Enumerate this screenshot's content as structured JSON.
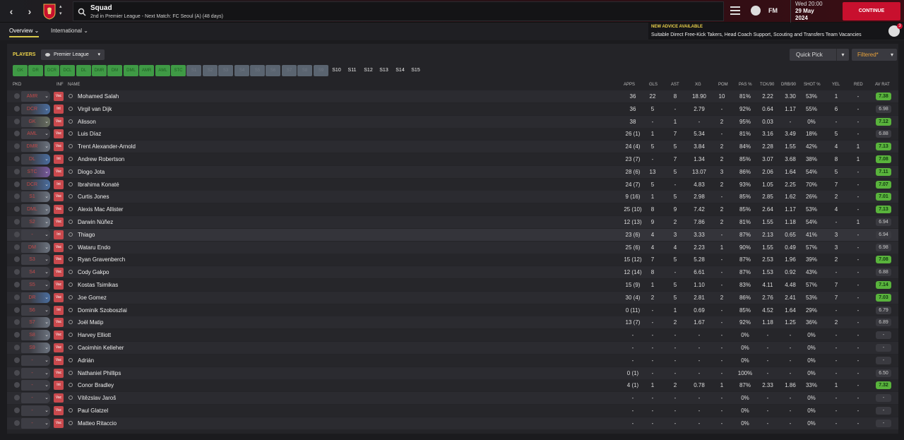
{
  "topbar": {
    "title": "Squad",
    "subtitle": "2nd in Premier League - Next Match: FC Seoul (A) (48 days)",
    "date_line1": "Wed 20:00",
    "date_line2": "29 May",
    "date_line3": "2024",
    "fm_label": "FM",
    "continue_label": "CONTINUE"
  },
  "tabs": [
    {
      "label": "Overview ⌄"
    },
    {
      "label": "International ⌄"
    }
  ],
  "advice": {
    "heading": "NEW ADVICE AVAILABLE",
    "body": "Suitable Direct Free-Kick Takers, Head Coach Support, Scouting and Transfers Team Vacancies",
    "badge": "3"
  },
  "panel": {
    "players_label": "PLAYERS",
    "league": "Premier League",
    "quick_pick": "Quick Pick",
    "filtered": "Filtered*"
  },
  "position_chips": [
    "GK",
    "DR",
    "DCR",
    "DCL",
    "DL",
    "DMR",
    "DM",
    "DML",
    "AMR",
    "AML",
    "STC",
    "S1",
    "S2",
    "S3",
    "S4",
    "S5",
    "S6",
    "S7",
    "S8",
    "S9",
    "S10",
    "S11",
    "S12",
    "S13",
    "S14",
    "S15"
  ],
  "columns": {
    "pkd": "PKD",
    "inf": "INF",
    "name": "NAME",
    "apps": "APPS",
    "gls": "GLS",
    "ast": "AST",
    "xg": "XG",
    "pom": "POM",
    "pas": "PAS %",
    "tck": "TCK/90",
    "drb": "DRB/90",
    "shot": "SHOT %",
    "yel": "YEL",
    "red": "RED",
    "avrat": "AV RAT"
  },
  "players": [
    {
      "pos": "AMR",
      "inf": "Vac",
      "name": "Mohamed Salah",
      "apps": "36",
      "gls": "22",
      "ast": "8",
      "xg": "18.90",
      "pom": "10",
      "pas": "81%",
      "tck": "2.22",
      "drb": "3.30",
      "shot": "53%",
      "yel": "1",
      "red": "-",
      "rat": "7.38",
      "good": true,
      "hue": "none"
    },
    {
      "pos": "DCR",
      "inf": "Int",
      "name": "Virgil van Dijk",
      "apps": "36",
      "gls": "5",
      "ast": "-",
      "xg": "2.79",
      "pom": "-",
      "pas": "92%",
      "tck": "0.64",
      "drb": "1.17",
      "shot": "55%",
      "yel": "6",
      "red": "-",
      "rat": "6.98",
      "good": false,
      "hue": "blu"
    },
    {
      "pos": "GK",
      "inf": "Vac",
      "name": "Alisson",
      "apps": "38",
      "gls": "-",
      "ast": "1",
      "xg": "-",
      "pom": "2",
      "pas": "95%",
      "tck": "0.03",
      "drb": "-",
      "shot": "0%",
      "yel": "-",
      "red": "-",
      "rat": "7.12",
      "good": true,
      "hue": "grn"
    },
    {
      "pos": "AML",
      "inf": "Vac",
      "name": "Luis Díaz",
      "apps": "26 (1)",
      "gls": "1",
      "ast": "7",
      "xg": "5.34",
      "pom": "-",
      "pas": "81%",
      "tck": "3.16",
      "drb": "3.49",
      "shot": "18%",
      "yel": "5",
      "red": "-",
      "rat": "6.88",
      "good": false,
      "hue": "none"
    },
    {
      "pos": "DMR",
      "inf": "Vac",
      "name": "Trent Alexander-Arnold",
      "apps": "24 (4)",
      "gls": "5",
      "ast": "5",
      "xg": "3.84",
      "pom": "2",
      "pas": "84%",
      "tck": "2.28",
      "drb": "1.55",
      "shot": "42%",
      "yel": "4",
      "red": "1",
      "rat": "7.13",
      "good": true,
      "hue": "gry"
    },
    {
      "pos": "DL",
      "inf": "Int",
      "name": "Andrew Robertson",
      "apps": "23 (7)",
      "gls": "-",
      "ast": "7",
      "xg": "1.34",
      "pom": "2",
      "pas": "85%",
      "tck": "3.07",
      "drb": "3.68",
      "shot": "38%",
      "yel": "8",
      "red": "1",
      "rat": "7.08",
      "good": true,
      "hue": "blu"
    },
    {
      "pos": "STC",
      "inf": "Vac",
      "name": "Diogo Jota",
      "apps": "28 (6)",
      "gls": "13",
      "ast": "5",
      "xg": "13.07",
      "pom": "3",
      "pas": "86%",
      "tck": "2.06",
      "drb": "1.64",
      "shot": "54%",
      "yel": "5",
      "red": "-",
      "rat": "7.11",
      "good": true,
      "hue": "pur"
    },
    {
      "pos": "DCR",
      "inf": "Int",
      "name": "Ibrahima Konaté",
      "apps": "24 (7)",
      "gls": "5",
      "ast": "-",
      "xg": "4.83",
      "pom": "2",
      "pas": "93%",
      "tck": "1.05",
      "drb": "2.25",
      "shot": "70%",
      "yel": "7",
      "red": "-",
      "rat": "7.07",
      "good": true,
      "hue": "blu"
    },
    {
      "pos": "S1",
      "inf": "Vac",
      "name": "Curtis Jones",
      "apps": "9 (16)",
      "gls": "1",
      "ast": "5",
      "xg": "2.98",
      "pom": "-",
      "pas": "85%",
      "tck": "2.85",
      "drb": "1.62",
      "shot": "26%",
      "yel": "2",
      "red": "-",
      "rat": "7.01",
      "good": true,
      "hue": "gry"
    },
    {
      "pos": "DML",
      "inf": "Vac",
      "name": "Alexis Mac Allister",
      "apps": "25 (10)",
      "gls": "8",
      "ast": "9",
      "xg": "7.42",
      "pom": "2",
      "pas": "85%",
      "tck": "2.64",
      "drb": "1.17",
      "shot": "53%",
      "yel": "4",
      "red": "-",
      "rat": "7.13",
      "good": true,
      "hue": "gry"
    },
    {
      "pos": "S2",
      "inf": "Vac",
      "name": "Darwin Núñez",
      "apps": "12 (13)",
      "gls": "9",
      "ast": "2",
      "xg": "7.86",
      "pom": "2",
      "pas": "81%",
      "tck": "1.55",
      "drb": "1.18",
      "shot": "54%",
      "yel": "-",
      "red": "1",
      "rat": "6.94",
      "good": false,
      "hue": "gry"
    },
    {
      "pos": "-",
      "inf": "Int",
      "name": "Thiago",
      "apps": "23 (6)",
      "gls": "4",
      "ast": "3",
      "xg": "3.33",
      "pom": "-",
      "pas": "87%",
      "tck": "2.13",
      "drb": "0.65",
      "shot": "41%",
      "yel": "3",
      "red": "-",
      "rat": "6.94",
      "good": false,
      "hue": "none"
    },
    {
      "pos": "DM",
      "inf": "Vac",
      "name": "Wataru Endo",
      "apps": "25 (6)",
      "gls": "4",
      "ast": "4",
      "xg": "2.23",
      "pom": "1",
      "pas": "90%",
      "tck": "1.55",
      "drb": "0.49",
      "shot": "57%",
      "yel": "3",
      "red": "-",
      "rat": "6.98",
      "good": false,
      "hue": "gry"
    },
    {
      "pos": "S3",
      "inf": "Vac",
      "name": "Ryan Gravenberch",
      "apps": "15 (12)",
      "gls": "7",
      "ast": "5",
      "xg": "5.28",
      "pom": "-",
      "pas": "87%",
      "tck": "2.53",
      "drb": "1.96",
      "shot": "39%",
      "yel": "2",
      "red": "-",
      "rat": "7.08",
      "good": true,
      "hue": "none"
    },
    {
      "pos": "S4",
      "inf": "Vac",
      "name": "Cody Gakpo",
      "apps": "12 (14)",
      "gls": "8",
      "ast": "-",
      "xg": "6.61",
      "pom": "-",
      "pas": "87%",
      "tck": "1.53",
      "drb": "0.92",
      "shot": "43%",
      "yel": "-",
      "red": "-",
      "rat": "6.88",
      "good": false,
      "hue": "none"
    },
    {
      "pos": "S5",
      "inf": "Vac",
      "name": "Kostas Tsimikas",
      "apps": "15 (9)",
      "gls": "1",
      "ast": "5",
      "xg": "1.10",
      "pom": "-",
      "pas": "83%",
      "tck": "4.11",
      "drb": "4.48",
      "shot": "57%",
      "yel": "7",
      "red": "-",
      "rat": "7.14",
      "good": true,
      "hue": "none"
    },
    {
      "pos": "DR",
      "inf": "Vac",
      "name": "Joe Gomez",
      "apps": "30 (4)",
      "gls": "2",
      "ast": "5",
      "xg": "2.81",
      "pom": "2",
      "pas": "86%",
      "tck": "2.76",
      "drb": "2.41",
      "shot": "53%",
      "yel": "7",
      "red": "-",
      "rat": "7.03",
      "good": true,
      "hue": "blu"
    },
    {
      "pos": "S6",
      "inf": "Int",
      "name": "Dominik Szoboszlai",
      "apps": "0 (11)",
      "gls": "-",
      "ast": "1",
      "xg": "0.69",
      "pom": "-",
      "pas": "85%",
      "tck": "4.52",
      "drb": "1.64",
      "shot": "29%",
      "yel": "-",
      "red": "-",
      "rat": "6.79",
      "good": false,
      "hue": "none"
    },
    {
      "pos": "S7",
      "inf": "Vac",
      "name": "Joël Matip",
      "apps": "13 (7)",
      "gls": "-",
      "ast": "2",
      "xg": "1.67",
      "pom": "-",
      "pas": "92%",
      "tck": "1.18",
      "drb": "1.25",
      "shot": "36%",
      "yel": "2",
      "red": "-",
      "rat": "6.89",
      "good": false,
      "hue": "gry"
    },
    {
      "pos": "S8",
      "inf": "Vac",
      "name": "Harvey Elliott",
      "apps": "-",
      "gls": "-",
      "ast": "-",
      "xg": "-",
      "pom": "-",
      "pas": "0%",
      "tck": "-",
      "drb": "-",
      "shot": "0%",
      "yel": "-",
      "red": "-",
      "rat": "-",
      "good": false,
      "hue": "gry"
    },
    {
      "pos": "S9",
      "inf": "Vac",
      "name": "Caoimhin Kelleher",
      "apps": "-",
      "gls": "-",
      "ast": "-",
      "xg": "-",
      "pom": "-",
      "pas": "0%",
      "tck": "-",
      "drb": "-",
      "shot": "0%",
      "yel": "-",
      "red": "-",
      "rat": "-",
      "good": false,
      "hue": "gry"
    },
    {
      "pos": "-",
      "inf": "Vac",
      "name": "Adrián",
      "apps": "-",
      "gls": "-",
      "ast": "-",
      "xg": "-",
      "pom": "-",
      "pas": "0%",
      "tck": "-",
      "drb": "-",
      "shot": "0%",
      "yel": "-",
      "red": "-",
      "rat": "-",
      "good": false,
      "hue": "none"
    },
    {
      "pos": "-",
      "inf": "Vac",
      "name": "Nathaniel Phillips",
      "apps": "0 (1)",
      "gls": "-",
      "ast": "-",
      "xg": "-",
      "pom": "-",
      "pas": "100%",
      "tck": "-",
      "drb": "-",
      "shot": "0%",
      "yel": "-",
      "red": "-",
      "rat": "6.50",
      "good": false,
      "hue": "none"
    },
    {
      "pos": "-",
      "inf": "Int",
      "name": "Conor Bradley",
      "apps": "4 (1)",
      "gls": "1",
      "ast": "2",
      "xg": "0.78",
      "pom": "1",
      "pas": "87%",
      "tck": "2.33",
      "drb": "1.86",
      "shot": "33%",
      "yel": "1",
      "red": "-",
      "rat": "7.32",
      "good": true,
      "hue": "none"
    },
    {
      "pos": "-",
      "inf": "Vac",
      "name": "Vítězslav Jaroš",
      "apps": "-",
      "gls": "-",
      "ast": "-",
      "xg": "-",
      "pom": "-",
      "pas": "0%",
      "tck": "-",
      "drb": "-",
      "shot": "0%",
      "yel": "-",
      "red": "-",
      "rat": "-",
      "good": false,
      "hue": "none"
    },
    {
      "pos": "-",
      "inf": "Vac",
      "name": "Paul Glatzel",
      "apps": "-",
      "gls": "-",
      "ast": "-",
      "xg": "-",
      "pom": "-",
      "pas": "0%",
      "tck": "-",
      "drb": "-",
      "shot": "0%",
      "yel": "-",
      "red": "-",
      "rat": "-",
      "good": false,
      "hue": "none"
    },
    {
      "pos": "-",
      "inf": "Vac",
      "name": "Matteo Ritaccio",
      "apps": "-",
      "gls": "-",
      "ast": "-",
      "xg": "-",
      "pom": "-",
      "pas": "0%",
      "tck": "-",
      "drb": "-",
      "shot": "0%",
      "yel": "-",
      "red": "-",
      "rat": "-",
      "good": false,
      "hue": "none"
    }
  ],
  "icons": {
    "back": "chevron-left-icon",
    "forward": "chevron-right-icon",
    "search": "search-icon",
    "menu": "hamburger-icon",
    "world": "globe-icon"
  },
  "colors": {
    "accent_red": "#c8102e",
    "rating_good": "#59b33c",
    "players_label": "#e9d04a",
    "filtered_text": "#e9a23a"
  }
}
